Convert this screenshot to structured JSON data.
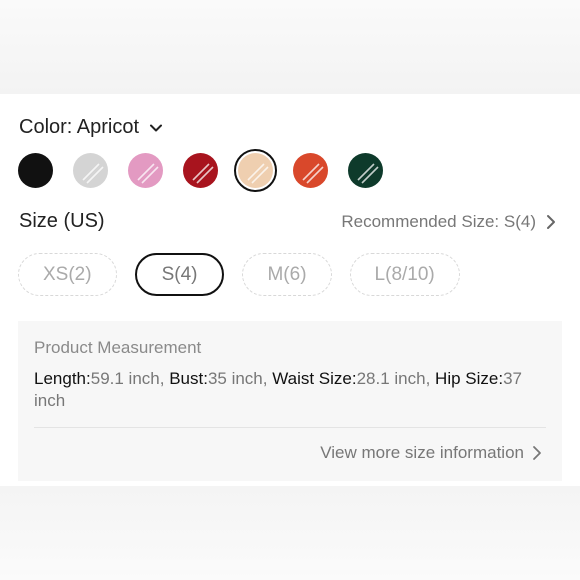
{
  "color": {
    "label": "Color: Apricot",
    "swatches": [
      {
        "name": "Black",
        "color": "#111111",
        "selected": false
      },
      {
        "name": "Grey",
        "color": "#d4d4d4",
        "selected": false
      },
      {
        "name": "Pink",
        "color": "#e39ac2",
        "selected": false
      },
      {
        "name": "Red",
        "color": "#a8141e",
        "selected": false
      },
      {
        "name": "Apricot",
        "color": "#efcfb0",
        "selected": true
      },
      {
        "name": "Orange",
        "color": "#d9482b",
        "selected": false
      },
      {
        "name": "Green",
        "color": "#0e3a2b",
        "selected": false
      }
    ]
  },
  "size": {
    "title": "Size (US)",
    "recommended": "Recommended Size: S(4)",
    "options": [
      {
        "label": "XS(2)",
        "selected": false
      },
      {
        "label": "S(4)",
        "selected": true
      },
      {
        "label": "M(6)",
        "selected": false
      },
      {
        "label": "L(8/10)",
        "selected": false
      }
    ]
  },
  "measurement": {
    "title": "Product Measurement",
    "length_key": "Length:",
    "length_val": "59.1 inch, ",
    "bust_key": "Bust:",
    "bust_val": "35 inch, ",
    "waist_key": "Waist Size:",
    "waist_val": "28.1 inch, ",
    "hip_key": "Hip Size:",
    "hip_val": "37 inch",
    "view_more": "View more size information"
  },
  "icons": {
    "color_dropdown": "chevron-down-icon",
    "recommended_arrow": "chevron-right-icon",
    "view_more_arrow": "chevron-right-icon"
  },
  "colors": {
    "selected_border": "#111111",
    "muted_text": "#777777",
    "dashed_border": "#d8d8d8"
  }
}
